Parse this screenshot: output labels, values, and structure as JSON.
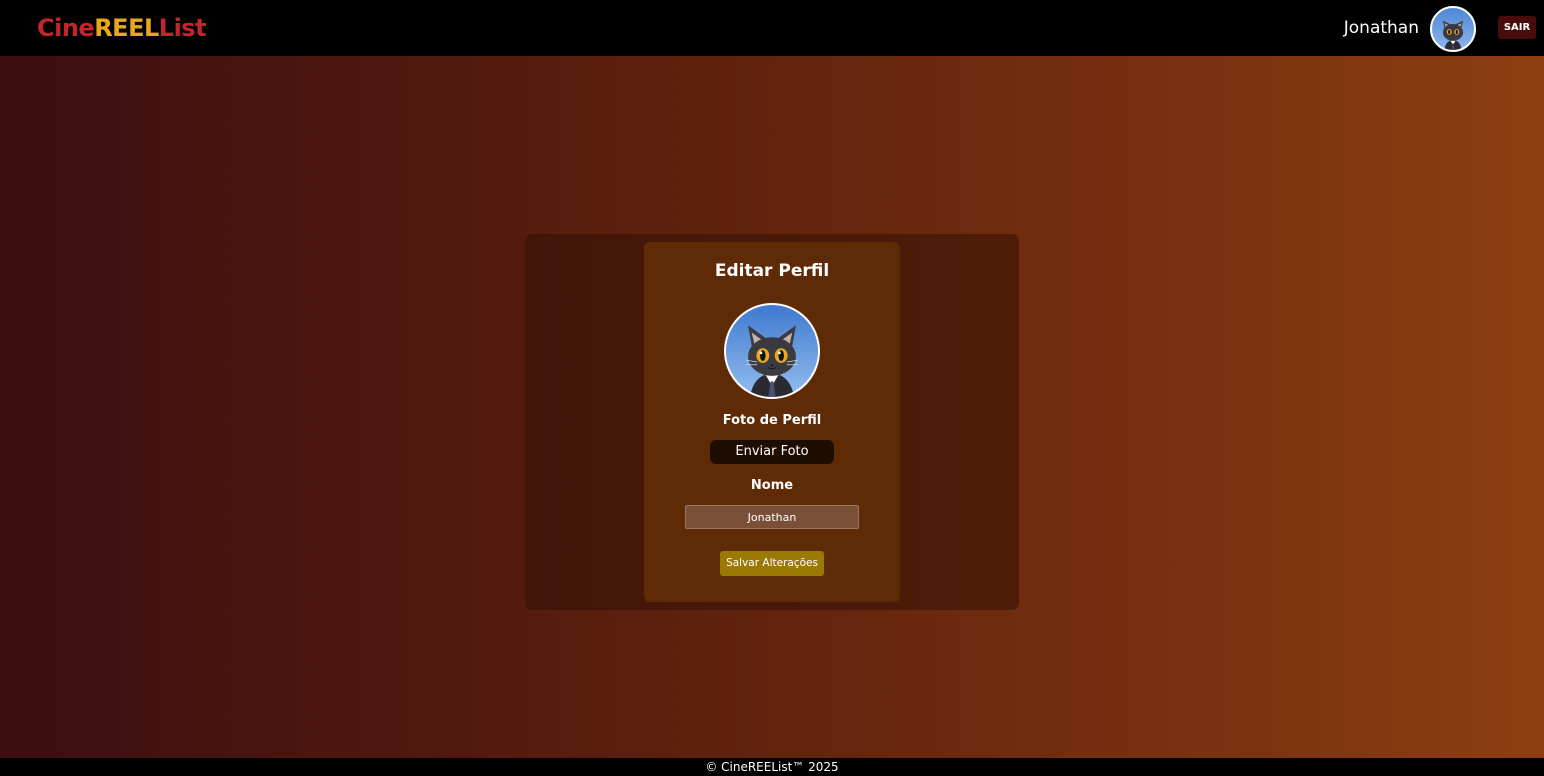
{
  "header": {
    "logo": {
      "part1": "Cine",
      "part2": "REEL",
      "part3": "ist",
      "part2_prefix": "",
      "full": "CineREEList"
    },
    "user_name": "Jonathan",
    "avatar_icon": "cat-avatar-icon",
    "logout_label": "SAIR"
  },
  "profile_card": {
    "title": "Editar Perfil",
    "avatar_icon": "cat-avatar-icon",
    "photo_label": "Foto de Perfil",
    "upload_label": "Enviar Foto",
    "name_label": "Nome",
    "name_value": "Jonathan",
    "save_label": "Salvar Alterações"
  },
  "footer": {
    "text": "© CineREEList™ 2025"
  },
  "colors": {
    "logo_red": "#c4252b",
    "logo_gold": "#e7a91a",
    "card_bg": "#5f2a06",
    "save_button": "#9c7905",
    "logout_button": "#4a0b0b"
  }
}
